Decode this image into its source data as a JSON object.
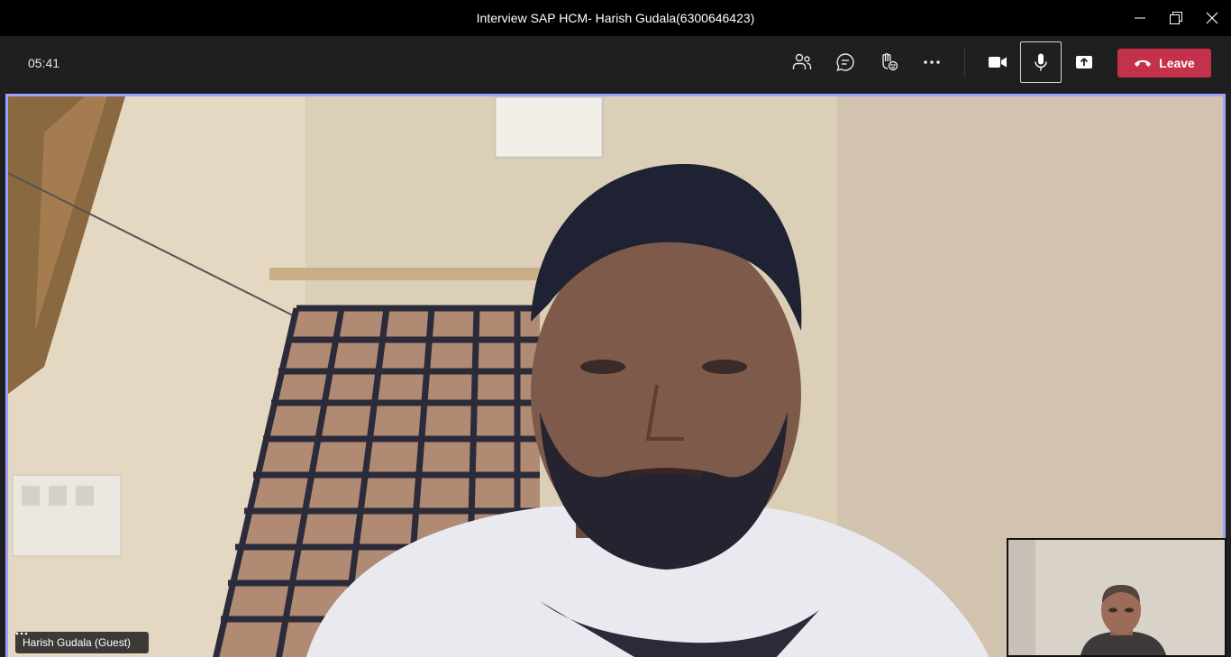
{
  "window": {
    "title": "Interview SAP HCM- Harish Gudala(6300646423)",
    "controls": [
      "minimize-icon",
      "restore-icon",
      "close-icon"
    ]
  },
  "toolbar": {
    "timer": "05:41",
    "buttons": [
      {
        "name": "participants",
        "icon": "people-icon"
      },
      {
        "name": "chat",
        "icon": "chat-icon"
      },
      {
        "name": "reactions",
        "icon": "raise-hand-icon"
      },
      {
        "name": "more",
        "icon": "more-icon"
      },
      {
        "name": "camera",
        "icon": "video-camera-icon"
      },
      {
        "name": "microphone",
        "icon": "microphone-icon",
        "active": true
      },
      {
        "name": "share",
        "icon": "share-screen-icon"
      }
    ],
    "leave_label": "Leave",
    "leave_color": "#c4314b"
  },
  "stage": {
    "participant_name": "Harish Gudala (Guest)",
    "highlight_color": "#9ea2ff"
  }
}
